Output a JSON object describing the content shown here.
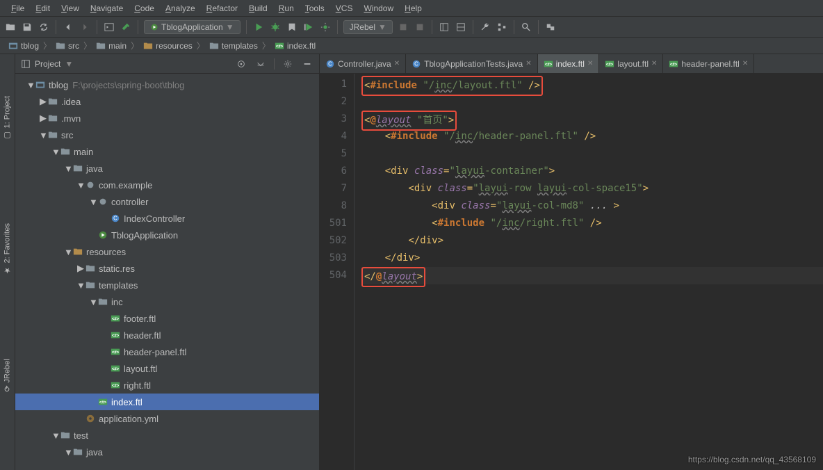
{
  "menu": [
    "File",
    "Edit",
    "View",
    "Navigate",
    "Code",
    "Analyze",
    "Refactor",
    "Build",
    "Run",
    "Tools",
    "VCS",
    "Window",
    "Help"
  ],
  "run_config": "TblogApplication",
  "jrebel_label": "JRebel",
  "breadcrumbs": [
    {
      "icon": "module",
      "label": "tblog"
    },
    {
      "icon": "folder",
      "label": "src"
    },
    {
      "icon": "folder",
      "label": "main"
    },
    {
      "icon": "res",
      "label": "resources"
    },
    {
      "icon": "folder",
      "label": "templates"
    },
    {
      "icon": "ftl",
      "label": "index.ftl"
    }
  ],
  "project_panel": {
    "title": "Project"
  },
  "tree": [
    {
      "depth": 0,
      "arrow": "▼",
      "icon": "module",
      "label": "tblog",
      "sub": "F:\\projects\\spring-boot\\tblog"
    },
    {
      "depth": 1,
      "arrow": "▶",
      "icon": "folder",
      "label": ".idea"
    },
    {
      "depth": 1,
      "arrow": "▶",
      "icon": "folder",
      "label": ".mvn"
    },
    {
      "depth": 1,
      "arrow": "▼",
      "icon": "folder",
      "label": "src"
    },
    {
      "depth": 2,
      "arrow": "▼",
      "icon": "folder",
      "label": "main"
    },
    {
      "depth": 3,
      "arrow": "▼",
      "icon": "folder",
      "label": "java"
    },
    {
      "depth": 4,
      "arrow": "▼",
      "icon": "pkg",
      "label": "com.example"
    },
    {
      "depth": 5,
      "arrow": "▼",
      "icon": "pkg",
      "label": "controller"
    },
    {
      "depth": 6,
      "arrow": "",
      "icon": "class",
      "label": "IndexController"
    },
    {
      "depth": 5,
      "arrow": "",
      "icon": "class-run",
      "label": "TblogApplication"
    },
    {
      "depth": 3,
      "arrow": "▼",
      "icon": "res",
      "label": "resources"
    },
    {
      "depth": 4,
      "arrow": "▶",
      "icon": "folder",
      "label": "static.res"
    },
    {
      "depth": 4,
      "arrow": "▼",
      "icon": "folder",
      "label": "templates"
    },
    {
      "depth": 5,
      "arrow": "▼",
      "icon": "folder",
      "label": "inc"
    },
    {
      "depth": 6,
      "arrow": "",
      "icon": "ftl",
      "label": "footer.ftl"
    },
    {
      "depth": 6,
      "arrow": "",
      "icon": "ftl",
      "label": "header.ftl"
    },
    {
      "depth": 6,
      "arrow": "",
      "icon": "ftl",
      "label": "header-panel.ftl"
    },
    {
      "depth": 6,
      "arrow": "",
      "icon": "ftl",
      "label": "layout.ftl"
    },
    {
      "depth": 6,
      "arrow": "",
      "icon": "ftl",
      "label": "right.ftl"
    },
    {
      "depth": 5,
      "arrow": "",
      "icon": "ftl",
      "label": "index.ftl",
      "selected": true
    },
    {
      "depth": 4,
      "arrow": "",
      "icon": "yml",
      "label": "application.yml"
    },
    {
      "depth": 2,
      "arrow": "▼",
      "icon": "folder",
      "label": "test"
    },
    {
      "depth": 3,
      "arrow": "▼",
      "icon": "folder",
      "label": "java"
    }
  ],
  "editor_tabs": [
    {
      "label": "Controller.java",
      "icon": "class",
      "truncated": true
    },
    {
      "label": "TblogApplicationTests.java",
      "icon": "class"
    },
    {
      "label": "index.ftl",
      "icon": "ftl",
      "active": true
    },
    {
      "label": "layout.ftl",
      "icon": "ftl"
    },
    {
      "label": "header-panel.ftl",
      "icon": "ftl"
    }
  ],
  "line_numbers": [
    "1",
    "2",
    "3",
    "4",
    "5",
    "6",
    "7",
    "8",
    "501",
    "502",
    "503",
    "504"
  ],
  "code_lines": [
    {
      "boxed": true,
      "html": "<span class='tok-tag'>&lt;</span><span class='tok-dir'>#include</span> <span class='tok-str'>\"</span><span class='tok-str'>/</span><span class='tok-str underline-wavy'>inc</span><span class='tok-str'>/layout.ftl\"</span> <span class='tok-tag'>/&gt;</span>"
    },
    {
      "html": ""
    },
    {
      "boxed": true,
      "html": "<span class='tok-tag'>&lt;</span><span class='tok-dir'>@</span><span class='tok-attrname underline-wavy' style='font-style:italic'>layout</span> <span class='tok-str'>\"首页\"</span><span class='tok-tag'>&gt;</span>"
    },
    {
      "indent": 1,
      "html": "<span class='tok-tag'>&lt;</span><span class='tok-dir'>#include</span> <span class='tok-str'>\"/</span><span class='tok-str underline-wavy'>inc</span><span class='tok-str'>/header-panel.ftl\"</span> <span class='tok-tag'>/&gt;</span>"
    },
    {
      "html": ""
    },
    {
      "indent": 1,
      "html": "<span class='tok-tag'>&lt;div </span><span class='tok-attrname'>class</span><span class='tok-tag'>=</span><span class='tok-str'>\"</span><span class='tok-str underline-wavy'>layui</span><span class='tok-str'>-container\"</span><span class='tok-tag'>&gt;</span>"
    },
    {
      "indent": 2,
      "html": "<span class='tok-tag'>&lt;div </span><span class='tok-attrname'>class</span><span class='tok-tag'>=</span><span class='tok-str'>\"</span><span class='tok-str underline-wavy'>layui</span><span class='tok-str'>-row </span><span class='tok-str underline-wavy'>layui</span><span class='tok-str'>-col-space15\"</span><span class='tok-tag'>&gt;</span>"
    },
    {
      "indent": 3,
      "html": "<span class='tok-tag'>&lt;div </span><span class='tok-attrname'>class</span><span class='tok-tag'>=</span><span class='tok-str'>\"</span><span class='tok-str underline-wavy'>layui</span><span class='tok-str'>-col-md8\"</span> <span class='tok-attr'>... </span><span class='tok-tag'>&gt;</span>"
    },
    {
      "indent": 3,
      "html": "<span class='tok-tag'>&lt;</span><span class='tok-dir'>#include</span> <span class='tok-str'>\"/</span><span class='tok-str underline-wavy'>inc</span><span class='tok-str'>/right.ftl\"</span> <span class='tok-tag'>/&gt;</span>"
    },
    {
      "indent": 2,
      "html": "<span class='tok-tag'>&lt;/div&gt;</span>"
    },
    {
      "indent": 1,
      "html": "<span class='tok-tag'>&lt;/div&gt;</span>"
    },
    {
      "boxed": true,
      "current": true,
      "html": "<span class='tok-tag'>&lt;/</span><span class='tok-dir'>@</span><span class='tok-attrname underline-wavy' style='font-style:italic'>layout</span><span class='tok-tag'>&gt;</span>"
    }
  ],
  "side_tabs": [
    {
      "label": "1: Project",
      "icon": "▢"
    },
    {
      "label": "2: Favorites",
      "icon": "★"
    },
    {
      "label": "JRebel",
      "icon": "⟳"
    }
  ],
  "watermark": "https://blog.csdn.net/qq_43568109"
}
